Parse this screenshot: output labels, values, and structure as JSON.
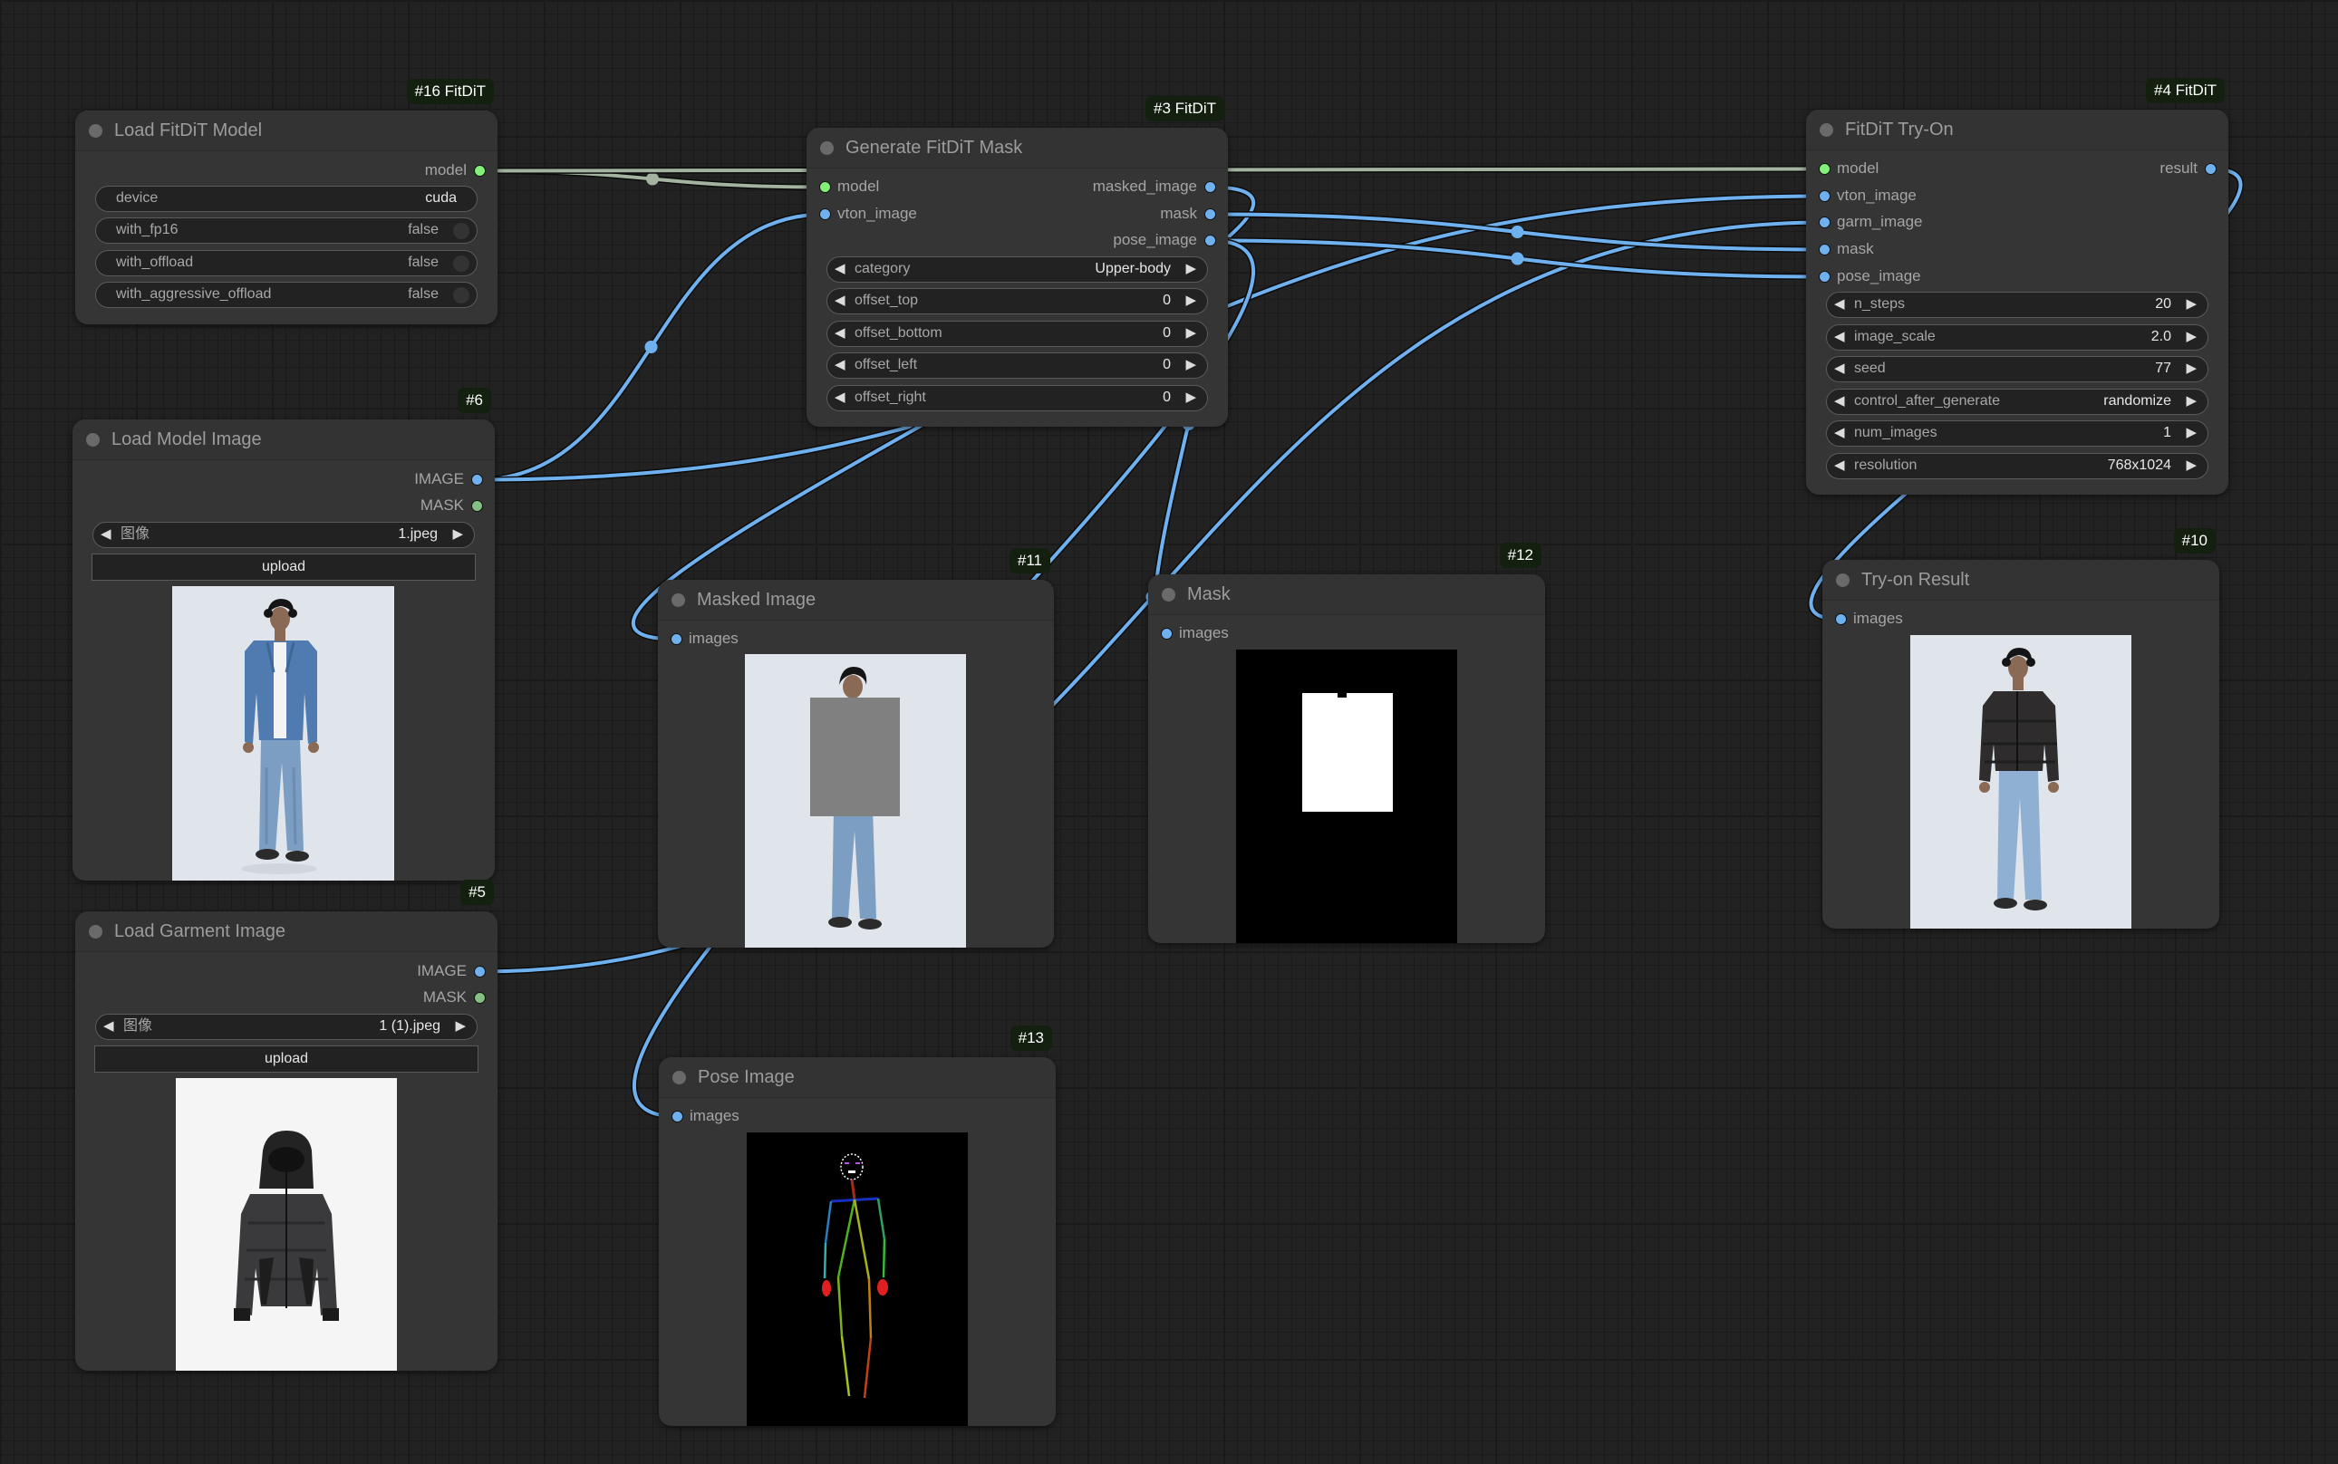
{
  "canvas": {
    "colors": {
      "background": "#222222",
      "node_body": "#353535",
      "image_link": "#6fb1ef",
      "model_link": "#a3b3a0",
      "model_port": "#83f07a",
      "mask_port": "#84c083",
      "badge_bg": "#14200f"
    }
  },
  "nodes": {
    "load_model": {
      "badge": "#16 FitDiT",
      "title": "Load FitDiT Model",
      "outputs": [
        "model"
      ],
      "widgets": [
        {
          "label": "device",
          "value": "cuda"
        },
        {
          "label": "with_fp16",
          "value": "false"
        },
        {
          "label": "with_offload",
          "value": "false"
        },
        {
          "label": "with_aggressive_offload",
          "value": "false"
        }
      ]
    },
    "gen_mask": {
      "badge": "#3 FitDiT",
      "title": "Generate FitDiT Mask",
      "inputs": [
        "model",
        "vton_image"
      ],
      "outputs": [
        "masked_image",
        "mask",
        "pose_image"
      ],
      "widgets": [
        {
          "label": "category",
          "value": "Upper-body"
        },
        {
          "label": "offset_top",
          "value": "0"
        },
        {
          "label": "offset_bottom",
          "value": "0"
        },
        {
          "label": "offset_left",
          "value": "0"
        },
        {
          "label": "offset_right",
          "value": "0"
        }
      ]
    },
    "tryon": {
      "badge": "#4 FitDiT",
      "title": "FitDiT Try-On",
      "inputs": [
        "model",
        "vton_image",
        "garm_image",
        "mask",
        "pose_image"
      ],
      "outputs": [
        "result"
      ],
      "widgets": [
        {
          "label": "n_steps",
          "value": "20"
        },
        {
          "label": "image_scale",
          "value": "2.0"
        },
        {
          "label": "seed",
          "value": "77"
        },
        {
          "label": "control_after_generate",
          "value": "randomize"
        },
        {
          "label": "num_images",
          "value": "1"
        },
        {
          "label": "resolution",
          "value": "768x1024"
        }
      ]
    },
    "model_image": {
      "badge": "#6",
      "title": "Load Model Image",
      "outputs": [
        "IMAGE",
        "MASK"
      ],
      "image_widget": {
        "label": "图像",
        "value": "1.jpeg"
      },
      "upload_label": "upload",
      "preview": "man-in-denim-jacket-photo"
    },
    "garment_image": {
      "badge": "#5",
      "title": "Load Garment Image",
      "outputs": [
        "IMAGE",
        "MASK"
      ],
      "image_widget": {
        "label": "图像",
        "value": "1 (1).jpeg"
      },
      "upload_label": "upload",
      "preview": "black-puffer-jacket-photo"
    },
    "masked_image": {
      "badge": "#11",
      "title": "Masked Image",
      "inputs": [
        "images"
      ],
      "preview": "masked-person-photo"
    },
    "mask": {
      "badge": "#12",
      "title": "Mask",
      "inputs": [
        "images"
      ],
      "preview": "binary-mask"
    },
    "pose_image": {
      "badge": "#13",
      "title": "Pose Image",
      "inputs": [
        "images"
      ],
      "preview": "pose-skeleton"
    },
    "tryon_result": {
      "badge": "#10",
      "title": "Try-on Result",
      "inputs": [
        "images"
      ],
      "preview": "man-in-puffer-jacket-photo"
    }
  },
  "links": [
    {
      "from": "load_model.model",
      "to": "gen_mask.model",
      "type": "model"
    },
    {
      "from": "load_model.model",
      "to": "tryon.model",
      "type": "model"
    },
    {
      "from": "model_image.IMAGE",
      "to": "gen_mask.vton_image",
      "type": "image"
    },
    {
      "from": "model_image.IMAGE",
      "to": "tryon.vton_image",
      "type": "image"
    },
    {
      "from": "garment_image.IMAGE",
      "to": "tryon.garm_image",
      "type": "image"
    },
    {
      "from": "gen_mask.masked_image",
      "to": "masked_image.images",
      "type": "image"
    },
    {
      "from": "gen_mask.mask",
      "to": "tryon.mask",
      "type": "image"
    },
    {
      "from": "gen_mask.mask",
      "to": "mask.images",
      "type": "image"
    },
    {
      "from": "gen_mask.pose_image",
      "to": "tryon.pose_image",
      "type": "image"
    },
    {
      "from": "gen_mask.pose_image",
      "to": "pose_image.images",
      "type": "image"
    },
    {
      "from": "tryon.result",
      "to": "tryon_result.images",
      "type": "image"
    }
  ]
}
